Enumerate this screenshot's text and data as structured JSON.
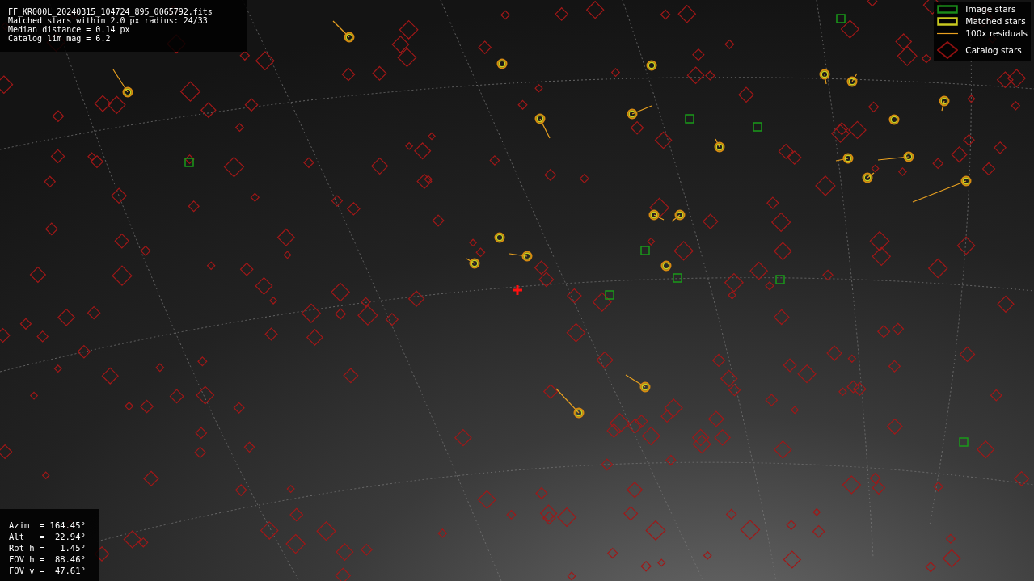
{
  "info_panel": {
    "lines": [
      "FF_KR000L_20240315_104724_895_0065792.fits",
      "Matched stars within 2.0 px radius: 24/33",
      "Median distance = 0.14 px",
      "Catalog lim mag = 6.2"
    ]
  },
  "legend": {
    "items": [
      {
        "kind": "image",
        "label": "Image stars"
      },
      {
        "kind": "matched",
        "label": "Matched stars"
      },
      {
        "kind": "residual",
        "label": "100x residuals"
      },
      {
        "kind": "catalog",
        "label": "Catalog stars"
      }
    ]
  },
  "pointing_panel": {
    "lines": [
      "Azim  = 164.45°",
      "Alt   =  22.94°",
      "Rot h =  -1.45°",
      "FOV h =  88.46°",
      "FOV v =  47.61°"
    ]
  }
}
